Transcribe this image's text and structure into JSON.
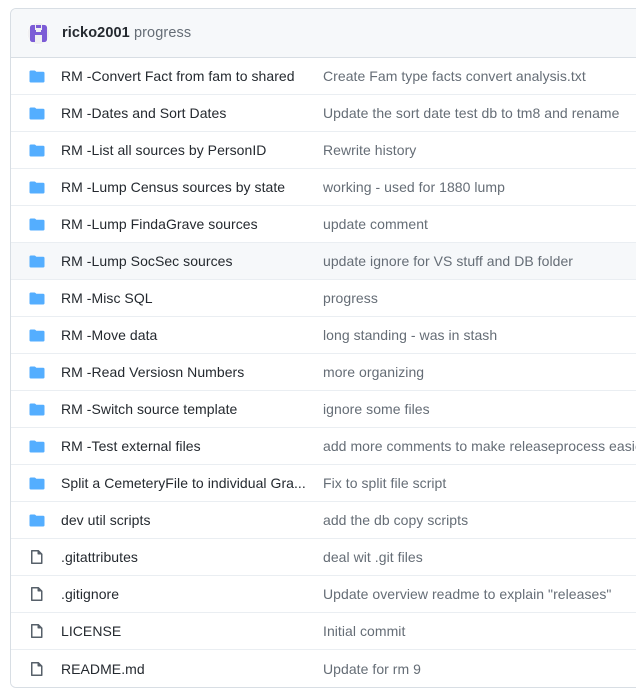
{
  "header": {
    "avatar_icon": "identicon-avatar",
    "avatar_color": "#7c5cd6",
    "owner": "ricko2001",
    "repo": "progress",
    "title": "ricko2001 progress"
  },
  "colors": {
    "folder_blue": "#54aeff",
    "file_outline": "#57606a",
    "border": "#d8dee4",
    "row_divider": "#eaeef2",
    "header_bg": "#f6f8fa",
    "hover_bg": "#f6f8fa",
    "name_text": "#24292f",
    "message_text": "#656d76"
  },
  "rows": [
    {
      "icon": "folder-icon",
      "type": "folder",
      "name": "RM -Convert Fact from fam to shared",
      "message": "Create Fam type facts convert analysis.txt",
      "hovered": false
    },
    {
      "icon": "folder-icon",
      "type": "folder",
      "name": "RM -Dates and Sort Dates",
      "message": "Update the sort date test db to tm8 and rename",
      "hovered": false
    },
    {
      "icon": "folder-icon",
      "type": "folder",
      "name": "RM -List all sources by PersonID",
      "message": "Rewrite history",
      "hovered": false
    },
    {
      "icon": "folder-icon",
      "type": "folder",
      "name": "RM -Lump Census sources by state",
      "message": "working - used for 1880 lump",
      "hovered": false
    },
    {
      "icon": "folder-icon",
      "type": "folder",
      "name": "RM -Lump FindaGrave sources",
      "message": "update comment",
      "hovered": false
    },
    {
      "icon": "folder-icon",
      "type": "folder",
      "name": "RM -Lump SocSec sources",
      "message": "update ignore for VS stuff and DB folder",
      "hovered": true
    },
    {
      "icon": "folder-icon",
      "type": "folder",
      "name": "RM -Misc SQL",
      "message": "progress",
      "hovered": false
    },
    {
      "icon": "folder-icon",
      "type": "folder",
      "name": "RM -Move data",
      "message": "long standing - was in stash",
      "hovered": false
    },
    {
      "icon": "folder-icon",
      "type": "folder",
      "name": "RM -Read Versiosn Numbers",
      "message": "more organizing",
      "hovered": false
    },
    {
      "icon": "folder-icon",
      "type": "folder",
      "name": "RM -Switch source template",
      "message": "ignore some files",
      "hovered": false
    },
    {
      "icon": "folder-icon",
      "type": "folder",
      "name": "RM -Test external files",
      "message": "add more comments to make releaseprocess easier",
      "hovered": false
    },
    {
      "icon": "folder-icon",
      "type": "folder",
      "name": "Split a CemeteryFile to individual Gra...",
      "message": "Fix to split file script",
      "hovered": false
    },
    {
      "icon": "folder-icon",
      "type": "folder",
      "name": "dev util scripts",
      "message": "add the db copy scripts",
      "hovered": false
    },
    {
      "icon": "file-icon",
      "type": "file",
      "name": ".gitattributes",
      "message": "deal wit .git files",
      "hovered": false
    },
    {
      "icon": "file-icon",
      "type": "file",
      "name": ".gitignore",
      "message": "Update overview readme to explain \"releases\"",
      "hovered": false
    },
    {
      "icon": "file-icon",
      "type": "file",
      "name": "LICENSE",
      "message": "Initial commit",
      "hovered": false
    },
    {
      "icon": "file-icon",
      "type": "file",
      "name": "README.md",
      "message": "Update for rm 9",
      "hovered": false
    }
  ]
}
